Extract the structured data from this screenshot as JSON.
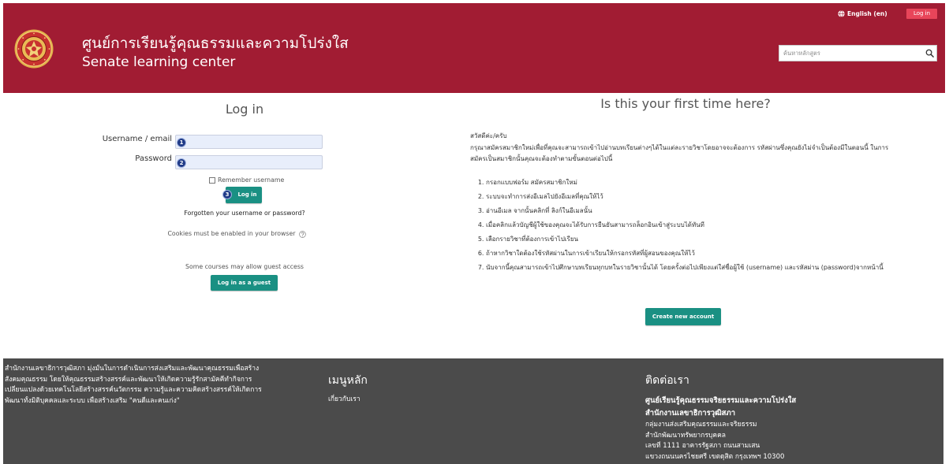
{
  "colors": {
    "brand": "#a11c33",
    "top_login": "#e8455a",
    "accent": "#1a9083",
    "footer": "#4b4b4b",
    "marker": "#1f3a87"
  },
  "icons": {
    "language": "globe-icon",
    "search": "search-icon",
    "help": "question-circle-icon",
    "logo": "senate-seal-logo"
  },
  "navbar": {
    "language_label": "English (en)",
    "login_label": "Log in"
  },
  "header": {
    "title_th": "ศูนย์การเรียนรู้คุณธรรมและความโปร่งใส",
    "title_en": "Senate learning center",
    "search": {
      "placeholder": "ค้นหาหลักสูตร",
      "value": ""
    }
  },
  "login": {
    "heading": "Log in",
    "username_label": "Username / email",
    "username_value": "",
    "password_label": "Password",
    "password_value": "",
    "remember_label": "Remember username",
    "remember_checked": false,
    "submit_label": "Log in",
    "forgot_link": "Forgotten your username or password?",
    "cookies_notice": "Cookies must be enabled in your browser",
    "guest_notice": "Some courses may allow guest access",
    "guest_button": "Log in as a guest"
  },
  "markers": [
    "1",
    "2",
    "3"
  ],
  "signup": {
    "heading": "Is this your first time here?",
    "greeting": "สวัสดีค่ะ/ครับ",
    "intro": "กรุณาสมัครสมาชิกใหม่เพื่อที่คุณจะสามารถเข้าไปอ่านบทเรียนต่างๆได้ในแต่ละรายวิชาโดยอาจจะต้องการ รหัสผ่านซึ่งคุณยังไม่จำเป็นต้องมีในตอนนี้ ในการสมัครเป็นสมาชิกนั้นคุณจะต้องทำตามขั้นตอนต่อไปนี้",
    "steps": [
      "กรอกแบบฟอร์ม สมัครสมาชิกใหม่",
      "ระบบจะทำการส่งอีเมลไปยังอีเมลที่คุณให้ไว้",
      "อ่านอีเมล จากนั้นคลิกที่ ลิงก์ในอีเมลนั้น",
      "เมื่อคลิกแล้วบัญชีผู้ใช้ของคุณจะได้รับการยืนยันสามารถล็อกอินเข้าสู่ระบบได้ทันที",
      "เลือกรายวิชาที่ต้องการเข้าไปเรียน",
      "ถ้าหากวิชาใดต้องใช้รหัสผ่านในการเข้าเรียนให้กรอกรหัสที่ผู้สอนของคุณให้ไว้",
      "นับจากนี้คุณสามารถเข้าไปศึกษาบทเรียนทุกบทในรายวิชานั้นได้ โดยครั้งต่อไปเพียงแต่ใส่ชื่อผู้ใช้ (username) และรหัสผ่าน (password)จากหน้านี้"
    ],
    "create_button": "Create new account"
  },
  "footer": {
    "about_lines": [
      "สำนักงานเลขาธิการวุฒิสภา มุ่งมั่นในการดำเนินการส่งเสริมและพัฒนาคุณธรรมเพื่อสร้าง",
      "สังคมคุณธรรม โดยให้คุณธรรมสร้างสรรค์และพัฒนาให้เกิดความรู้รักสามัคคีทำกิจการ",
      "เปลี่ยนแปลงด้วยเทคโนโลยีสร้างสรรค์นวัตกรรม ความรู้และความคิดสร้างสรรค์ให้เกิดการ",
      "พัฒนาทั้งมิติบุคคลและระบบ เพื่อสร้างเสริม \"คนดีและคนเก่ง\""
    ],
    "menu": {
      "heading": "เมนูหลัก",
      "links": [
        "เกี่ยวกับเรา"
      ]
    },
    "contact": {
      "heading": "ติดต่อเรา",
      "strong_lines": [
        "ศูนย์เรียนรู้คุณธรรมจริยธรรมและความโปร่งใส",
        "สำนักงานเลขาธิการวุฒิสภา"
      ],
      "lines": [
        "กลุ่มงานส่งเสริมคุณธรรมและจริยธรรม",
        "สำนักพัฒนาทรัพยากรบุคคล",
        "เลขที่ 1111 อาคารรัฐสภา ถนนสามเสน",
        "แขวงถนนนครไชยศรี เขตดุสิต กรุงเทพฯ 10300"
      ]
    }
  }
}
